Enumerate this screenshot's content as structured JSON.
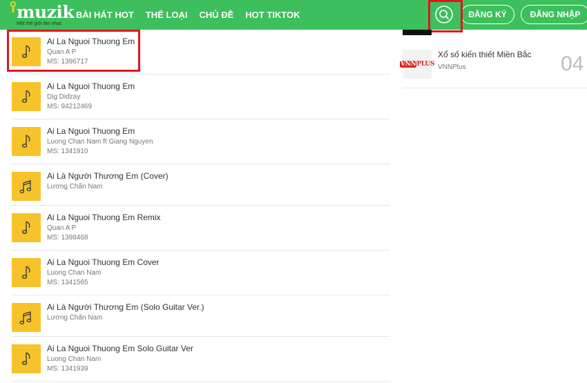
{
  "header": {
    "logo_text": "muzik",
    "logo_slogan": "Một thế giới âm nhạc",
    "nav": [
      "BÀI HÁT HOT",
      "THỂ LOẠI",
      "CHỦ ĐỀ",
      "HOT TIKTOK"
    ],
    "register_label": "ĐĂNG KÝ",
    "login_label": "ĐĂNG NHẬP",
    "brand_color": "#3cbf5c"
  },
  "songs": [
    {
      "title": "Ai La Nguoi Thuong Em",
      "artist": "Quan A P",
      "code": "MS: 1396717",
      "icon": "single-note-icon"
    },
    {
      "title": "Ai La Nguoi Thuong Em",
      "artist": "Dig Didzay",
      "code": "MS: 94212469",
      "icon": "single-note-icon"
    },
    {
      "title": "Ai La Nguoi Thuong Em",
      "artist": "Luong Chan Nam ft Giang Nguyen",
      "code": "MS: 1341910",
      "icon": "single-note-icon"
    },
    {
      "title": "Ai Là Người Thương Em (Cover)",
      "artist": "Lương Chấn Nam",
      "code": "",
      "icon": "double-note-icon"
    },
    {
      "title": "Ai La Nguoi Thuong Em Remix",
      "artist": "Quan A P",
      "code": "MS: 1398468",
      "icon": "single-note-icon"
    },
    {
      "title": "Ai La Nguoi Thuong Em Cover",
      "artist": "Luong Chan Nam",
      "code": "MS: 1341565",
      "icon": "single-note-icon"
    },
    {
      "title": "Ai Là Người Thương Em (Solo Guitar Ver.)",
      "artist": "Lương Chấn Nam",
      "code": "",
      "icon": "double-note-icon"
    },
    {
      "title": "Ai La Nguoi Thuong Em Solo Guitar Ver",
      "artist": "Luong Chan Nam",
      "code": "MS: 1341939",
      "icon": "single-note-icon"
    }
  ],
  "side": {
    "item_title": "Xổ số kiến thiết Miền Bắc",
    "item_source": "VNNPlus",
    "item_rank": "04",
    "logo_text_a": "VNN",
    "logo_text_b": "PLUS"
  },
  "thumb_color": "#f6c32b",
  "highlight_color": "#e0161e"
}
